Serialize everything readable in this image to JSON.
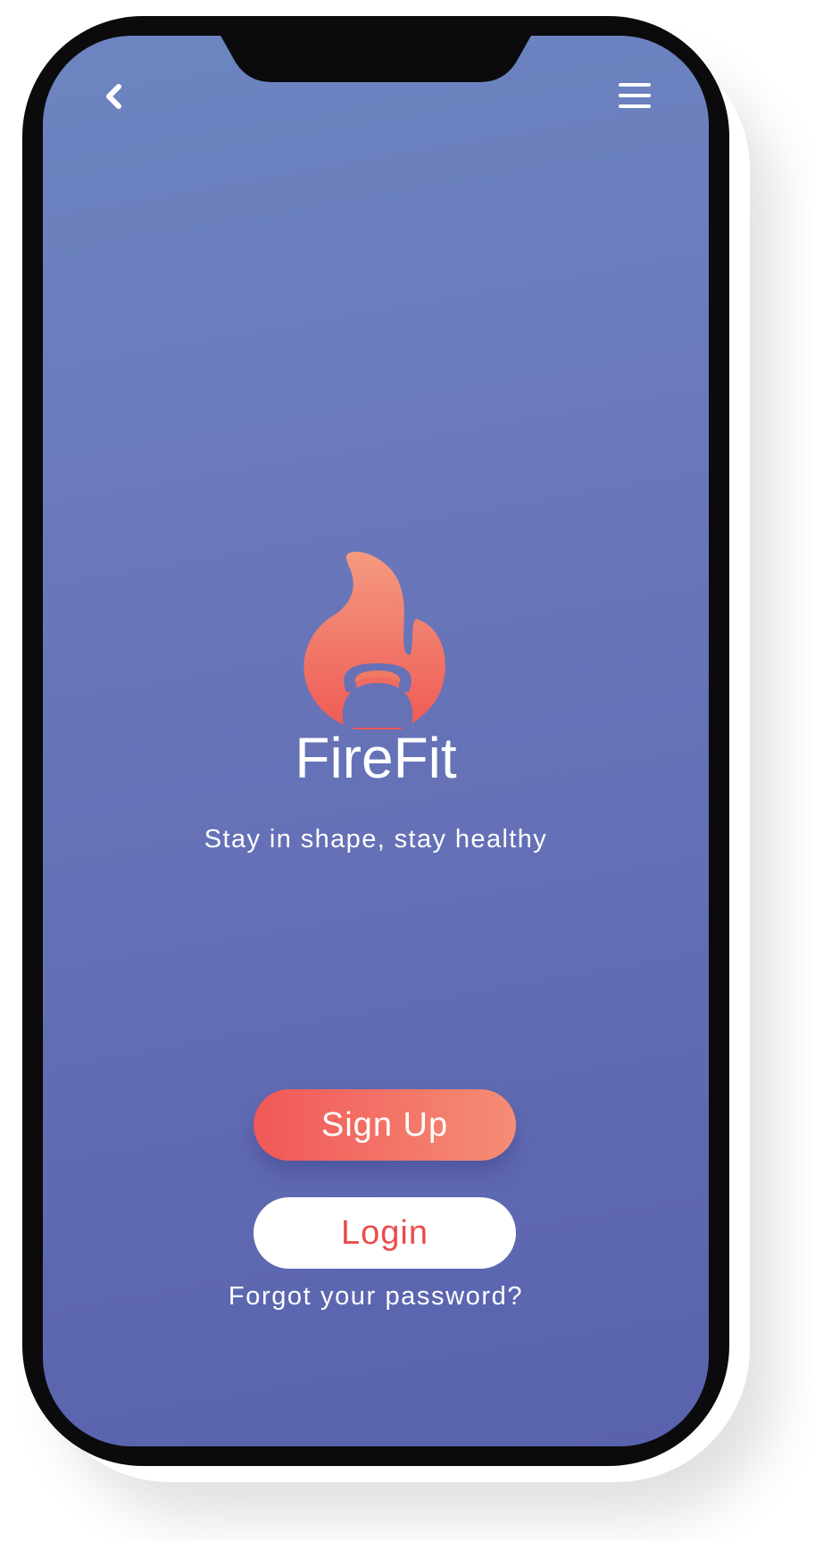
{
  "app": {
    "name": "FireFit",
    "tagline": "Stay in shape, stay healthy"
  },
  "nav": {
    "back_icon": "chevron-left-icon",
    "menu_icon": "hamburger-menu-icon"
  },
  "logo": {
    "icon": "flame-kettlebell-icon"
  },
  "actions": {
    "signup_label": "Sign Up",
    "login_label": "Login",
    "forgot_label": "Forgot your password?"
  },
  "colors": {
    "background_top": "#6d85c1",
    "background_bottom": "#5962ad",
    "accent_start": "#f05858",
    "accent_end": "#f58d75",
    "login_text": "#ea4c4c"
  }
}
